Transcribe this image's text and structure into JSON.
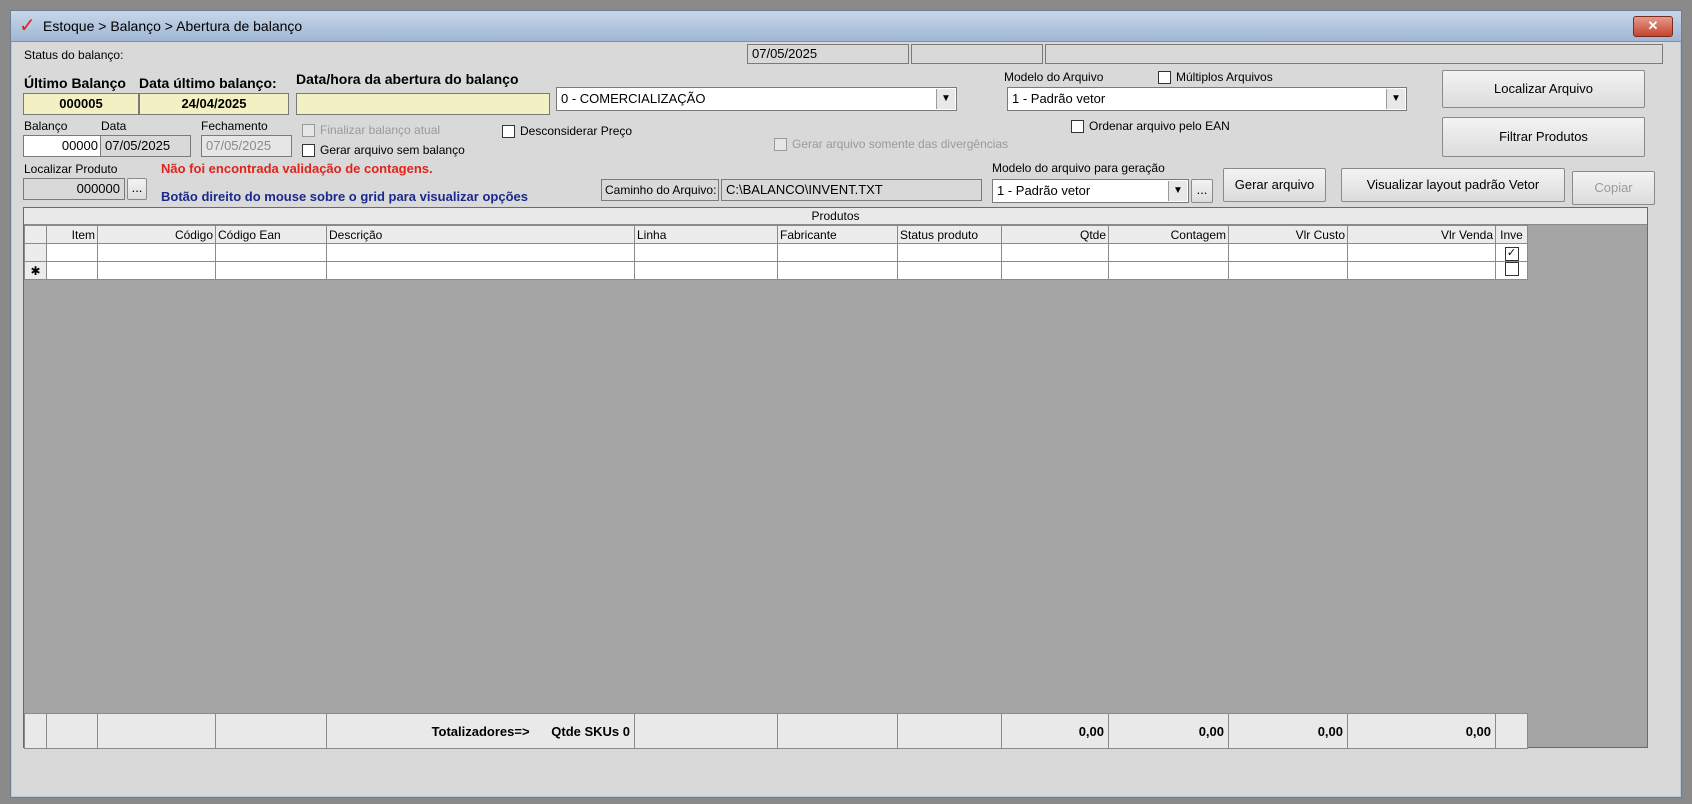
{
  "window": {
    "title": "Estoque > Balanço > Abertura de balanço",
    "close_label": "✕"
  },
  "status_bar": {
    "label": "Status do balanço:",
    "date": "07/05/2025"
  },
  "ultimo_balanco": {
    "label": "Último Balanço",
    "value": "000005"
  },
  "data_ultimo_balanco": {
    "label": "Data último balanço:",
    "value": "24/04/2025"
  },
  "data_hora_abertura": {
    "label": "Data/hora da abertura do balanço",
    "value": ""
  },
  "tipo_select": {
    "value": "0 - COMERCIALIZAÇÃO"
  },
  "modelo_arquivo": {
    "label": "Modelo do Arquivo",
    "value": "1 - Padrão vetor"
  },
  "multiplos_arquivos": {
    "label": "Múltiplos Arquivos",
    "checked": false
  },
  "buttons": {
    "localizar_arquivo": "Localizar Arquivo",
    "filtrar_produtos": "Filtrar Produtos",
    "gerar_arquivo": "Gerar arquivo",
    "visualizar_layout": "Visualizar layout padrão Vetor",
    "copiar": "Copiar",
    "ellipsis": "..."
  },
  "balanco": {
    "label": "Balanço",
    "value": "00000"
  },
  "data": {
    "label": "Data",
    "value": "07/05/2025"
  },
  "fechamento": {
    "label": "Fechamento",
    "value": "07/05/2025"
  },
  "checkboxes": {
    "finalizar_balanco": "Finalizar balanço atual",
    "gerar_sem_balanco": "Gerar arquivo sem balanço",
    "desconsiderar_preco": "Desconsiderar Preço",
    "gerar_somente_divergencias": "Gerar arquivo somente das divergências",
    "ordenar_ean": "Ordenar arquivo pelo EAN"
  },
  "localizar_produto": {
    "label": "Localizar Produto",
    "value": "000000"
  },
  "messages": {
    "warning": "Não foi encontrada validação de contagens.",
    "hint": "Botão direito do mouse sobre o grid para visualizar opções"
  },
  "caminho_arquivo": {
    "label": "Caminho do Arquivo:",
    "value": "C:\\BALANCO\\INVENT.TXT"
  },
  "modelo_geracao": {
    "label": "Modelo do arquivo para geração",
    "value": "1 - Padrão vetor"
  },
  "grid": {
    "caption": "Produtos",
    "columns": [
      "Item",
      "Código",
      "Código Ean",
      "Descrição",
      "Linha",
      "Fabricante",
      "Status produto",
      "Qtde",
      "Contagem",
      "Vlr Custo",
      "Vlr Venda",
      "Inve"
    ],
    "new_row_marker": "✱",
    "inve_checked": "✓"
  },
  "totals": {
    "label": "Totalizadores=>",
    "skus": "Qtde SKUs 0",
    "qtde": "0,00",
    "contagem": "0,00",
    "vlr_custo": "0,00",
    "vlr_venda": "0,00"
  }
}
